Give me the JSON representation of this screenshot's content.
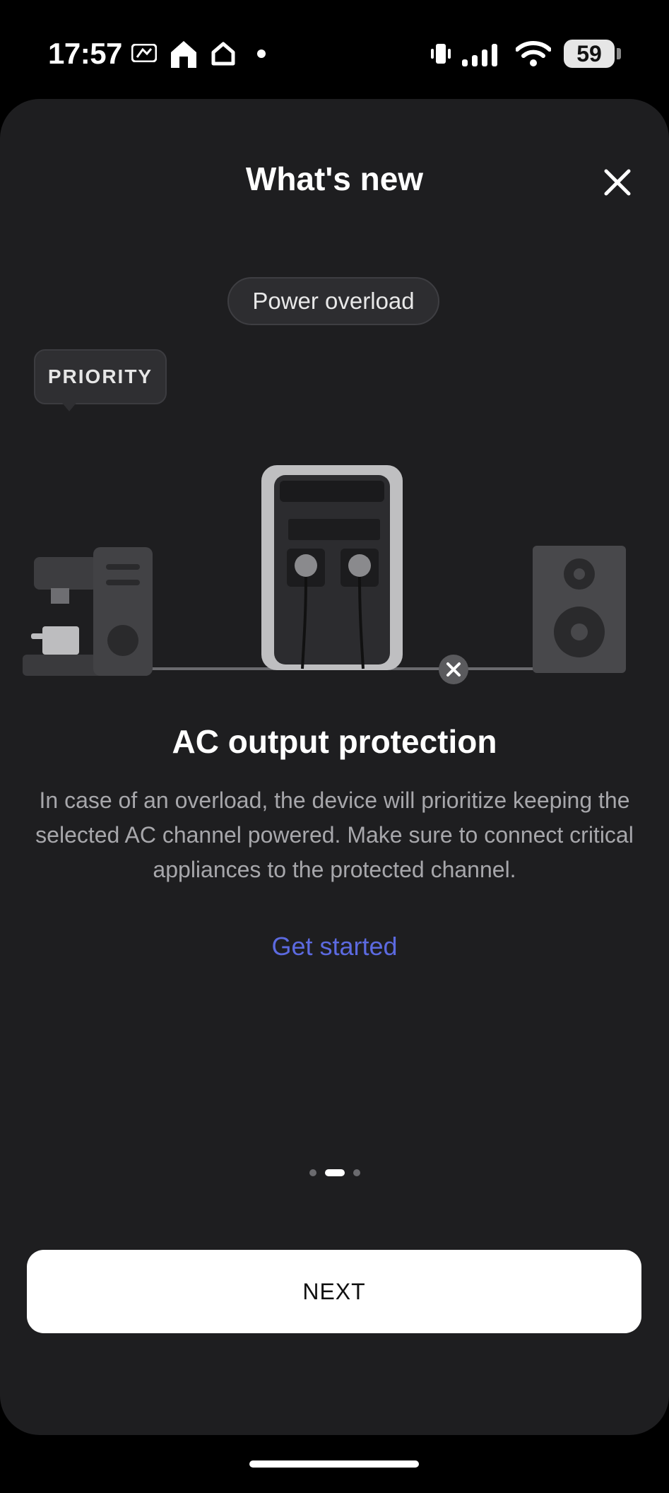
{
  "status_bar": {
    "time": "17:57",
    "battery_level": "59",
    "icons": [
      "mlb-icon",
      "home-icon",
      "home-outline-icon",
      "dot-icon",
      "vibrate-icon",
      "signal-icon",
      "wifi-icon",
      "battery-icon"
    ]
  },
  "sheet": {
    "title": "What's new",
    "close_icon": "close-icon"
  },
  "illustration": {
    "pill_label": "Power overload",
    "priority_label": "PRIORITY",
    "icons": [
      "coffee-machine-icon",
      "power-station-icon",
      "speaker-icon",
      "disconnect-x-icon"
    ]
  },
  "content": {
    "headline": "AC output protection",
    "description": "In case of an overload, the device will prioritize keeping the selected AC channel powered. Make sure to connect critical appliances to the protected channel.",
    "link": "Get started"
  },
  "pagination": {
    "total": 3,
    "active_index": 1
  },
  "footer": {
    "next_label": "NEXT"
  },
  "colors": {
    "sheet_background": "#1e1e20",
    "link": "#5c6ae0",
    "button_background": "#ffffff"
  }
}
